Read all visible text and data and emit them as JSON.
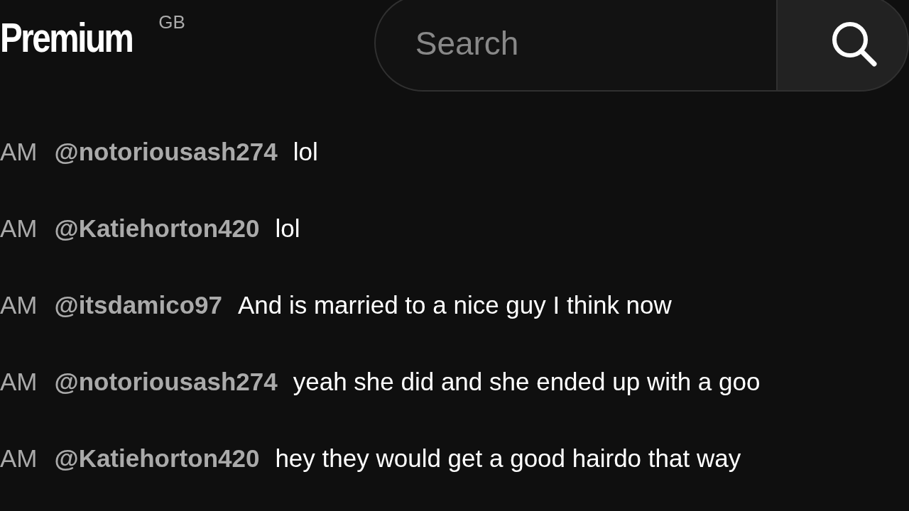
{
  "header": {
    "logo_text": "Premium",
    "region": "GB",
    "search": {
      "placeholder": "Search"
    }
  },
  "messages": [
    {
      "time": "AM",
      "author": "@notoriousash274",
      "text": "lol"
    },
    {
      "time": "AM",
      "author": "@Katiehorton420",
      "text": "lol"
    },
    {
      "time": "AM",
      "author": "@itsdamico97",
      "text": "And is married to a nice guy I think now"
    },
    {
      "time": "AM",
      "author": "@notoriousash274",
      "text": "yeah she did and she ended up with a goo"
    },
    {
      "time": "AM",
      "author": "@Katiehorton420",
      "text": "hey they would get a good hairdo that way"
    }
  ]
}
